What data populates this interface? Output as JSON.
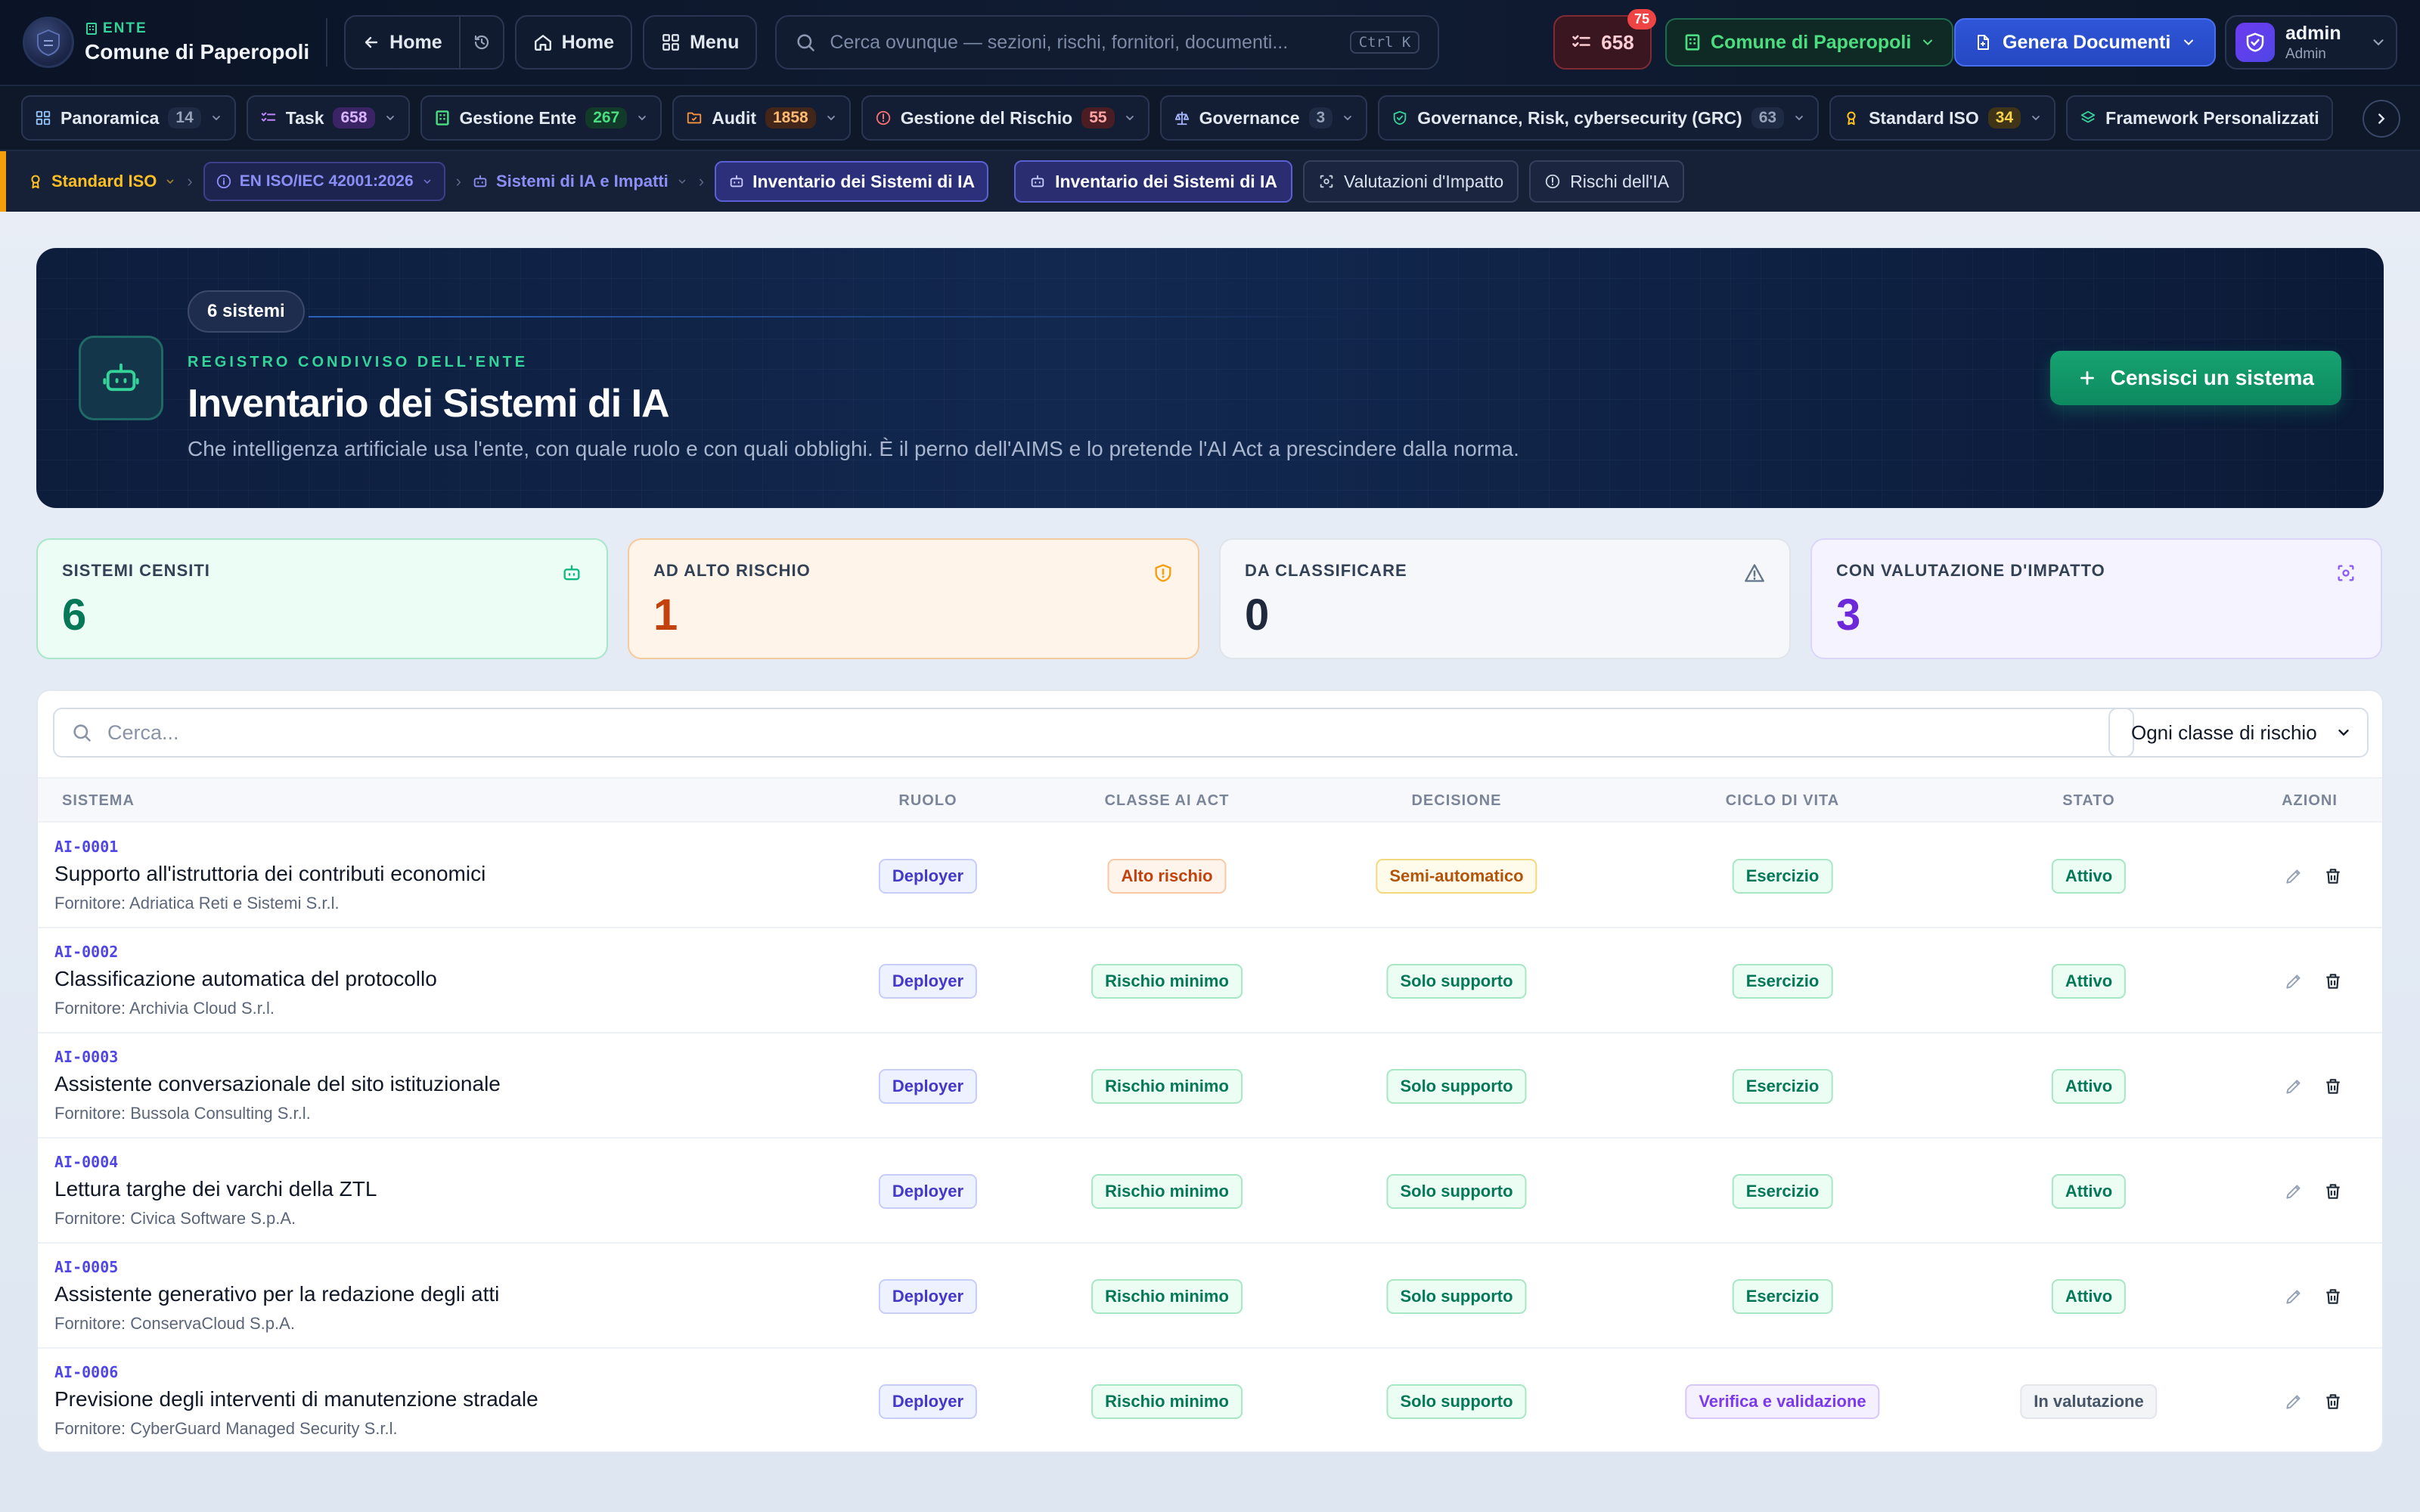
{
  "topbar": {
    "ente_tag": "ENTE",
    "ente_name": "Comune di Paperopoli",
    "back_home_label": "Home",
    "home_label": "Home",
    "menu_label": "Menu",
    "search_placeholder": "Cerca ovunque — sezioni, rischi, fornitori, documenti...",
    "search_shortcut": "Ctrl K",
    "task_count": "658",
    "task_notification": "75",
    "ente_selector": "Comune di Paperopoli",
    "generate_label": "Genera Documenti",
    "user_name": "admin",
    "user_role": "Admin"
  },
  "modules": [
    {
      "label": "Panoramica",
      "count": "14",
      "icon": "grid-icon",
      "color": "#93c5fd",
      "count_bg": "#1f2a44",
      "count_color": "#94a3b8"
    },
    {
      "label": "Task",
      "count": "658",
      "icon": "checklist-icon",
      "color": "#c084fc",
      "count_bg": "#3b2466",
      "count_color": "#d8b4fe"
    },
    {
      "label": "Gestione Ente",
      "count": "267",
      "icon": "building-icon",
      "color": "#4ade80",
      "count_bg": "#123a2a",
      "count_color": "#4ade80"
    },
    {
      "label": "Audit",
      "count": "1858",
      "icon": "folder-icon",
      "color": "#fb923c",
      "count_bg": "#42261a",
      "count_color": "#fdba74"
    },
    {
      "label": "Gestione del Rischio",
      "count": "55",
      "icon": "alert-icon",
      "color": "#f87171",
      "count_bg": "#4a1c24",
      "count_color": "#fca5a5"
    },
    {
      "label": "Governance",
      "count": "3",
      "icon": "scale-icon",
      "color": "#a5b4fc",
      "count_bg": "#1f2a44",
      "count_color": "#94a3b8"
    },
    {
      "label": "Governance, Risk, cybersecurity (GRC)",
      "count": "63",
      "icon": "shield-check-icon",
      "color": "#34d399",
      "count_bg": "#1f2a44",
      "count_color": "#94a3b8"
    },
    {
      "label": "Standard ISO",
      "count": "34",
      "icon": "award-icon",
      "color": "#fbbf24",
      "count_bg": "#3f3417",
      "count_color": "#fcd34d"
    },
    {
      "label": "Framework Personalizzati",
      "count": "",
      "icon": "layers-icon",
      "color": "#34d399",
      "count_bg": "",
      "count_color": ""
    }
  ],
  "breadcrumb": {
    "root": "Standard ISO",
    "standard": "EN ISO/IEC 42001:2026",
    "section": "Sistemi di IA e Impatti",
    "current": "Inventario dei Sistemi di IA"
  },
  "subtabs": [
    {
      "label": "Inventario dei Sistemi di IA",
      "active": true
    },
    {
      "label": "Valutazioni d'Impatto",
      "active": false
    },
    {
      "label": "Rischi dell'IA",
      "active": false
    }
  ],
  "hero": {
    "count_label": "6 sistemi",
    "kicker": "REGISTRO CONDIVISO DELL'ENTE",
    "title": "Inventario dei Sistemi di IA",
    "subtitle": "Che intelligenza artificiale usa l'ente, con quale ruolo e con quali obblighi. È il perno dell'AIMS e lo pretende l'AI Act a prescindere dalla norma.",
    "cta_label": "Censisci un sistema"
  },
  "kpis": [
    {
      "label": "SISTEMI CENSITI",
      "value": "6",
      "icon": "robot-icon",
      "bg": "#ecfdf5",
      "border": "#a7e7c9",
      "label_color": "#334155",
      "value_color": "#047857",
      "icon_color": "#10b981"
    },
    {
      "label": "AD ALTO RISCHIO",
      "value": "1",
      "icon": "shield-alert-icon",
      "bg": "#fff4ea",
      "border": "#f9c89d",
      "label_color": "#334155",
      "value_color": "#c2410c",
      "icon_color": "#f59e0b"
    },
    {
      "label": "DA CLASSIFICARE",
      "value": "0",
      "icon": "warning-icon",
      "bg": "#f5f7fa",
      "border": "#e0e5ec",
      "label_color": "#334155",
      "value_color": "#1e293b",
      "icon_color": "#64748b"
    },
    {
      "label": "CON VALUTAZIONE D'IMPATTO",
      "value": "3",
      "icon": "scan-icon",
      "bg": "#f5f3ff",
      "border": "#dcd5fb",
      "label_color": "#334155",
      "value_color": "#6d28d9",
      "icon_color": "#8b5cf6"
    }
  ],
  "table": {
    "search_placeholder": "Cerca...",
    "filter_selected": "Ogni classe di rischio",
    "columns": [
      "SISTEMA",
      "RUOLO",
      "CLASSE AI ACT",
      "DECISIONE",
      "CICLO DI VITA",
      "STATO",
      "AZIONI"
    ],
    "rows": [
      {
        "code": "AI-0001",
        "title": "Supporto all'istruttoria dei contributi economici",
        "provider": "Fornitore: Adriatica Reti e Sistemi S.r.l.",
        "role": "Deployer",
        "risk": "Alto rischio",
        "risk_kind": "high",
        "decision": "Semi-automatico",
        "decision_kind": "semi",
        "lifecycle": "Esercizio",
        "lifecycle_kind": "op",
        "status": "Attivo",
        "status_kind": "active"
      },
      {
        "code": "AI-0002",
        "title": "Classificazione automatica del protocollo",
        "provider": "Fornitore: Archivia Cloud S.r.l.",
        "role": "Deployer",
        "risk": "Rischio minimo",
        "risk_kind": "min",
        "decision": "Solo supporto",
        "decision_kind": "sup",
        "lifecycle": "Esercizio",
        "lifecycle_kind": "op",
        "status": "Attivo",
        "status_kind": "active"
      },
      {
        "code": "AI-0003",
        "title": "Assistente conversazionale del sito istituzionale",
        "provider": "Fornitore: Bussola Consulting S.r.l.",
        "role": "Deployer",
        "risk": "Rischio minimo",
        "risk_kind": "min",
        "decision": "Solo supporto",
        "decision_kind": "sup",
        "lifecycle": "Esercizio",
        "lifecycle_kind": "op",
        "status": "Attivo",
        "status_kind": "active"
      },
      {
        "code": "AI-0004",
        "title": "Lettura targhe dei varchi della ZTL",
        "provider": "Fornitore: Civica Software S.p.A.",
        "role": "Deployer",
        "risk": "Rischio minimo",
        "risk_kind": "min",
        "decision": "Solo supporto",
        "decision_kind": "sup",
        "lifecycle": "Esercizio",
        "lifecycle_kind": "op",
        "status": "Attivo",
        "status_kind": "active"
      },
      {
        "code": "AI-0005",
        "title": "Assistente generativo per la redazione degli atti",
        "provider": "Fornitore: ConservaCloud S.p.A.",
        "role": "Deployer",
        "risk": "Rischio minimo",
        "risk_kind": "min",
        "decision": "Solo supporto",
        "decision_kind": "sup",
        "lifecycle": "Esercizio",
        "lifecycle_kind": "op",
        "status": "Attivo",
        "status_kind": "active"
      },
      {
        "code": "AI-0006",
        "title": "Previsione degli interventi di manutenzione stradale",
        "provider": "Fornitore: CyberGuard Managed Security S.r.l.",
        "role": "Deployer",
        "risk": "Rischio minimo",
        "risk_kind": "min",
        "decision": "Solo supporto",
        "decision_kind": "sup",
        "lifecycle": "Verifica e validazione",
        "lifecycle_kind": "val",
        "status": "In valutazione",
        "status_kind": "eval"
      }
    ]
  }
}
